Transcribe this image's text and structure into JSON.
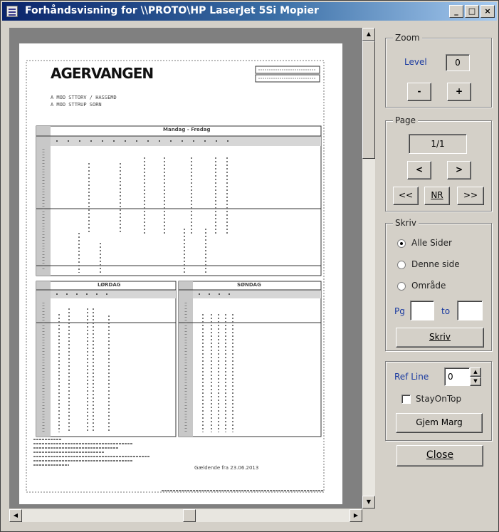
{
  "window": {
    "title": "Forhåndsvisning for \\\\PROTO\\HP LaserJet 5Si Mopier",
    "min_glyph": "_",
    "max_glyph": "□",
    "close_glyph": "×"
  },
  "document": {
    "heading": "AGERVANGEN",
    "sub1": "A MOD STTORV / HASSEMD",
    "sub2": "A MOD STTRUP SORN",
    "table1_title": "Mandag - Fredag",
    "table2_title": "LØRDAG",
    "table3_title": "SØNDAG",
    "footer": "Gældende fra 23.06.2013"
  },
  "zoom": {
    "legend": "Zoom",
    "level_label": "Level",
    "level_value": "0",
    "minus_label": "-",
    "plus_label": "+"
  },
  "page": {
    "legend": "Page",
    "display": "1/1",
    "prev_label": "<",
    "next_label": ">",
    "first_label": "<<",
    "nr_label": "NR",
    "last_label": ">>"
  },
  "print": {
    "legend": "Skriv",
    "options": [
      "Alle Sider",
      "Denne side",
      "Område"
    ],
    "selected_index": 0,
    "pg_label": "Pg",
    "to_label": "to",
    "pg_value": "",
    "to_value": "",
    "print_button": "Skriv"
  },
  "ref": {
    "ref_line_label": "Ref Line",
    "ref_line_value": "0",
    "stay_on_top_label": "StayOnTop",
    "stay_on_top_checked": false,
    "remove_margin_label": "Gjem Marg"
  },
  "close_label": "Close"
}
